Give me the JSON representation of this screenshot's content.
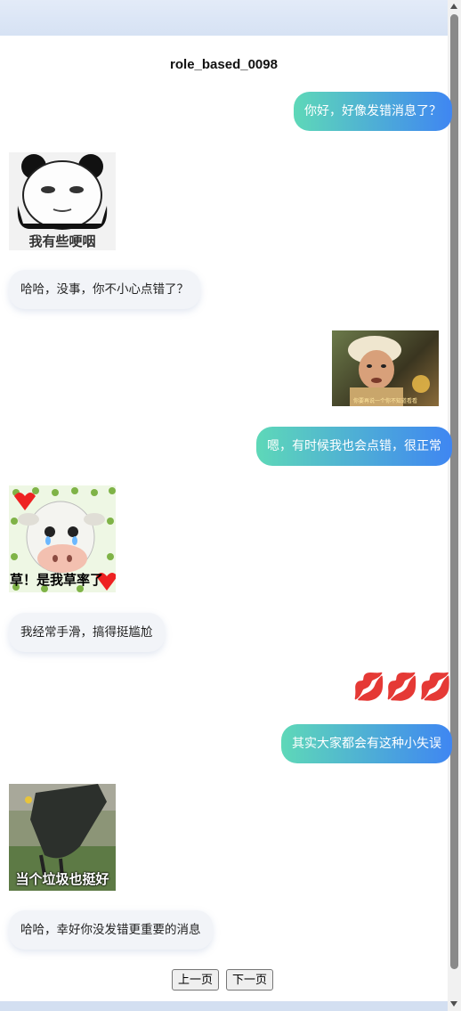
{
  "chat": {
    "title": "role_based_0098",
    "messages": [
      {
        "side": "right",
        "text": "你好，好像发错消息了？"
      },
      {
        "side": "left",
        "sticker_caption": "我有些哽咽"
      },
      {
        "side": "left",
        "text": "哈哈，没事，你不小心点错了？"
      },
      {
        "side": "right",
        "sticker_caption": "你要再说一个你不知道看看"
      },
      {
        "side": "right",
        "text": "嗯，有时候我也会点错，很正常"
      },
      {
        "side": "left",
        "sticker_caption": "草！是我草率了"
      },
      {
        "side": "left",
        "text": "我经常手滑，搞得挺尴尬"
      },
      {
        "side": "right",
        "emoji": "💋💋💋"
      },
      {
        "side": "right",
        "text": "其实大家都会有这种小失误"
      },
      {
        "side": "left",
        "sticker_caption": "当个垃圾也挺好"
      },
      {
        "side": "left",
        "text": "哈哈，幸好你没发错更重要的消息"
      }
    ]
  },
  "pagination": {
    "prev_label": "上一页",
    "next_label": "下一页"
  },
  "colors": {
    "bubble_gradient_start": "#5ed8b8",
    "bubble_gradient_end": "#3f86f2",
    "left_bubble_bg": "#f2f4f8"
  }
}
